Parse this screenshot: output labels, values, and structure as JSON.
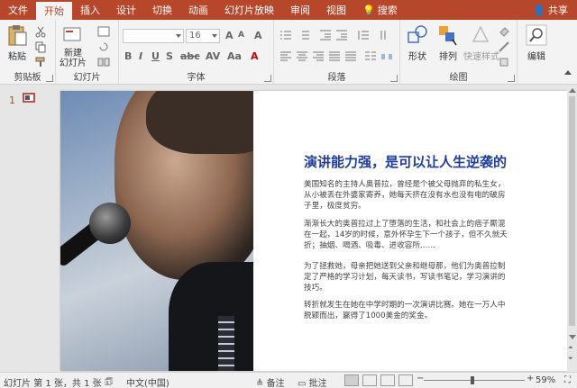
{
  "tabs": [
    "文件",
    "开始",
    "插入",
    "设计",
    "切换",
    "动画",
    "幻灯片放映",
    "审阅",
    "视图"
  ],
  "active_tab": "开始",
  "search_label": "搜索",
  "share_label": "共享",
  "ribbon": {
    "clipboard": {
      "paste": "粘贴",
      "label": "剪贴板"
    },
    "slides": {
      "new_slide": "新建\n幻灯片",
      "label": "幻灯片"
    },
    "font": {
      "font_name": "",
      "font_size": "16",
      "label": "字体"
    },
    "paragraph": {
      "label": "段落"
    },
    "drawing": {
      "shape": "形状",
      "arrange": "排列",
      "quick_styles": "快速样式",
      "label": "绘图"
    },
    "editing": {
      "label": "编辑"
    }
  },
  "thumbnail": {
    "number": "1"
  },
  "slide": {
    "title": "演讲能力强，是可以让人生逆袭的",
    "paragraphs": [
      "美国知名的主持人奥普拉，曾经是个被父母抛弃的私生女，从小被丢在外婆家寄养，她每天挤在没有水也没有电的破房子里，极度贫穷。",
      "渐渐长大的奥普拉过上了堕落的生活，和社会上的痞子厮混在一起，14岁的时候，意外怀孕生下一个孩子，但不久就夭折；抽烟、喝酒、吸毒、进收容所……",
      "为了拯救她，母亲把她送到父亲和继母那，他们为奥普拉制定了严格的学习计划，每天读书，写读书笔记，学习演讲的技巧。",
      "转折就发生在她在中学时期的一次演讲比赛。她在一万人中脱颖而出，赢得了1000美金的奖金。"
    ]
  },
  "status": {
    "slide_info": "幻灯片 第 1 张，共 1 张",
    "language": "中文(中国)",
    "notes": "备注",
    "comments": "批注",
    "zoom": "59%",
    "zoom_fraction": 0.59
  },
  "colors": {
    "accent": "#b7472a",
    "title": "#1f3d9c"
  }
}
